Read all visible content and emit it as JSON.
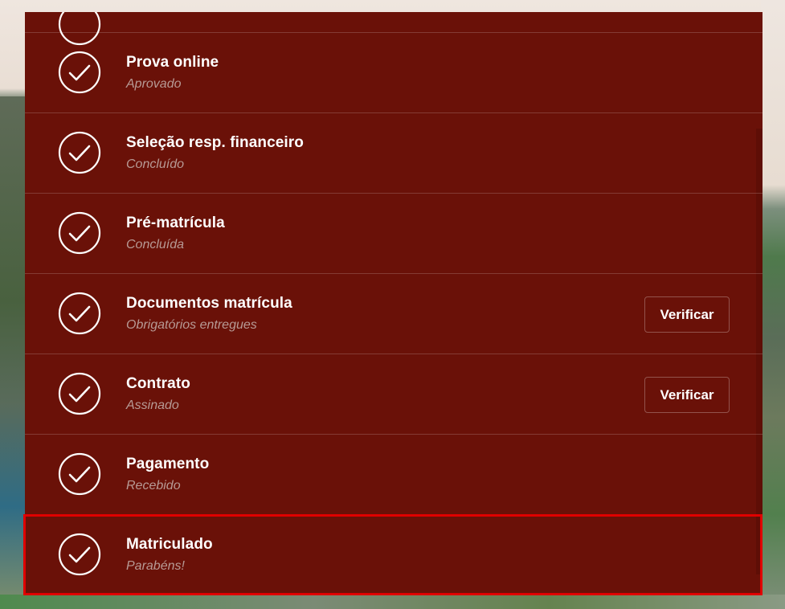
{
  "steps": [
    {
      "title": "Prova online",
      "subtitle": "Aprovado"
    },
    {
      "title": "Seleção resp. financeiro",
      "subtitle": "Concluído"
    },
    {
      "title": "Pré-matrícula",
      "subtitle": "Concluída"
    },
    {
      "title": "Documentos matrícula",
      "subtitle": "Obrigatórios entregues",
      "action": "Verificar"
    },
    {
      "title": "Contrato",
      "subtitle": "Assinado",
      "action": "Verificar"
    },
    {
      "title": "Pagamento",
      "subtitle": "Recebido"
    },
    {
      "title": "Matriculado",
      "subtitle": "Parabéns!"
    }
  ],
  "icons": {
    "status": "check-circle-icon"
  },
  "colors": {
    "panel_bg": "#6a1108",
    "title_text": "#ffffff",
    "subtitle_text": "#b79a95",
    "highlight_border": "#e00000"
  }
}
